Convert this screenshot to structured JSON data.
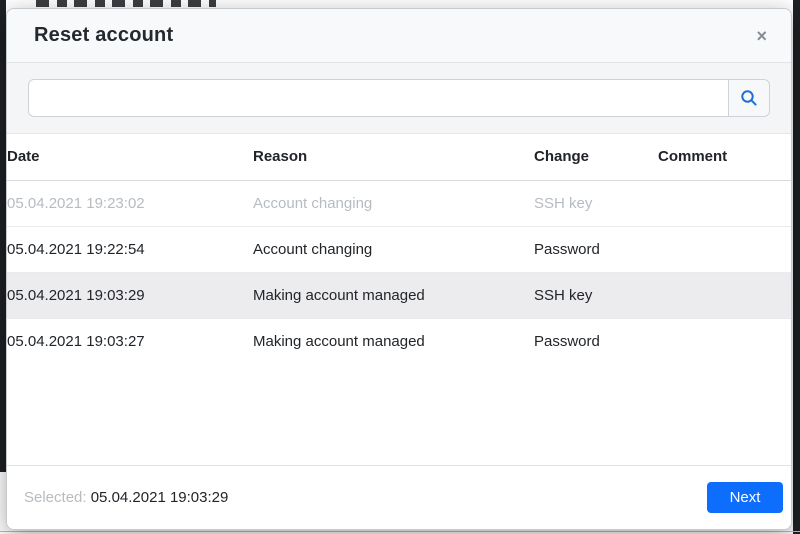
{
  "modal": {
    "title": "Reset account",
    "close_glyph": "×"
  },
  "search": {
    "value": "",
    "placeholder": "",
    "icon": "magnifier",
    "icon_color": "#1b6fd6"
  },
  "table": {
    "columns": [
      "Date",
      "Reason",
      "Change",
      "Comment"
    ],
    "rows": [
      {
        "date": "05.04.2021 19:23:02",
        "reason": "Account changing",
        "change": "SSH key",
        "comment": "",
        "state": "disabled"
      },
      {
        "date": "05.04.2021 19:22:54",
        "reason": "Account changing",
        "change": "Password",
        "comment": "",
        "state": "normal"
      },
      {
        "date": "05.04.2021 19:03:29",
        "reason": "Making account managed",
        "change": "SSH key",
        "comment": "",
        "state": "selected"
      },
      {
        "date": "05.04.2021 19:03:27",
        "reason": "Making account managed",
        "change": "Password",
        "comment": "",
        "state": "normal"
      }
    ]
  },
  "footer": {
    "selected_label": "Selected:",
    "selected_value": "05.04.2021 19:03:29",
    "next_label": "Next"
  },
  "colors": {
    "primary": "#0d6efd",
    "header_bg": "#f8f9fb",
    "search_section_bg": "#f4f5f7",
    "selected_row_bg": "#ececee",
    "muted_text": "#b7bcc1",
    "text": "#212529"
  }
}
